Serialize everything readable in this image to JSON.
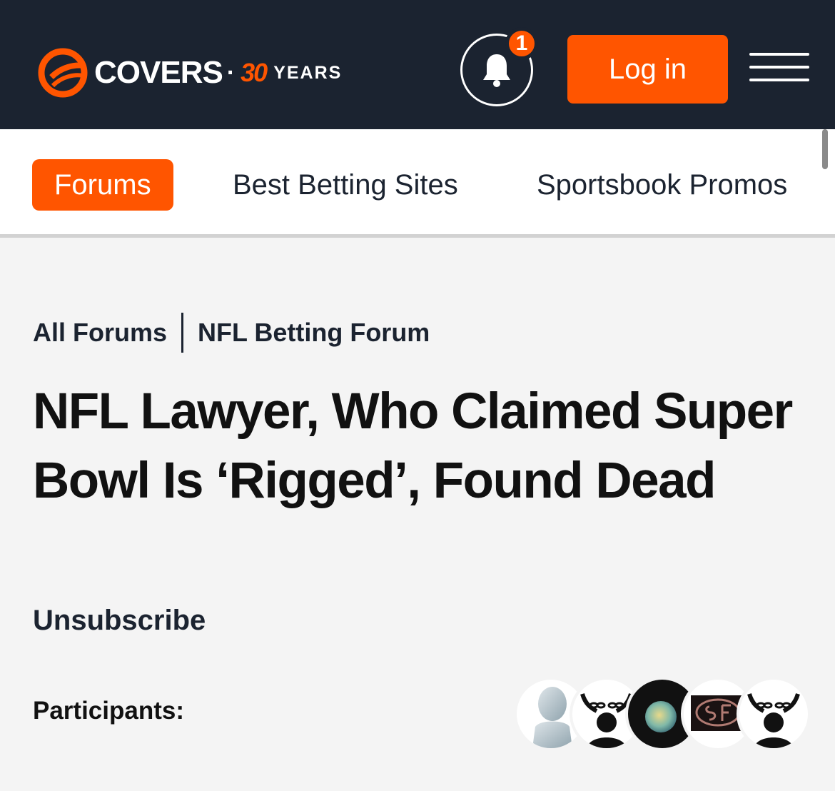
{
  "header": {
    "logo": {
      "word": "COVERS",
      "separator": "·",
      "anniversary": "30",
      "years": "YEARS",
      "icon": "covers-ball-icon"
    },
    "notifications": {
      "icon": "bell-icon",
      "count": "1"
    },
    "login_label": "Log in",
    "menu_icon": "hamburger-menu-icon"
  },
  "nav": {
    "items": [
      {
        "label": "Forums",
        "active": true
      },
      {
        "label": "Best Betting Sites",
        "active": false
      },
      {
        "label": "Sportsbook Promos",
        "active": false
      }
    ]
  },
  "breadcrumb": {
    "items": [
      "All Forums",
      "NFL Betting Forum"
    ]
  },
  "thread": {
    "title": "NFL Lawyer, Who Claimed Super Bowl Is ‘Rigged’, Found Dead",
    "unsubscribe_label": "Unsubscribe",
    "participants_label": "Participants:"
  },
  "participants": [
    {
      "avatar": "default-silhouette-avatar"
    },
    {
      "avatar": "broken-chains-silhouette-avatar"
    },
    {
      "avatar": "planet-avatar"
    },
    {
      "avatar": "sf-logo-avatar"
    },
    {
      "avatar": "broken-chains-silhouette-avatar"
    }
  ],
  "colors": {
    "brand_orange": "#ff5500",
    "header_navy": "#1b2330",
    "page_background": "#f4f4f4"
  }
}
